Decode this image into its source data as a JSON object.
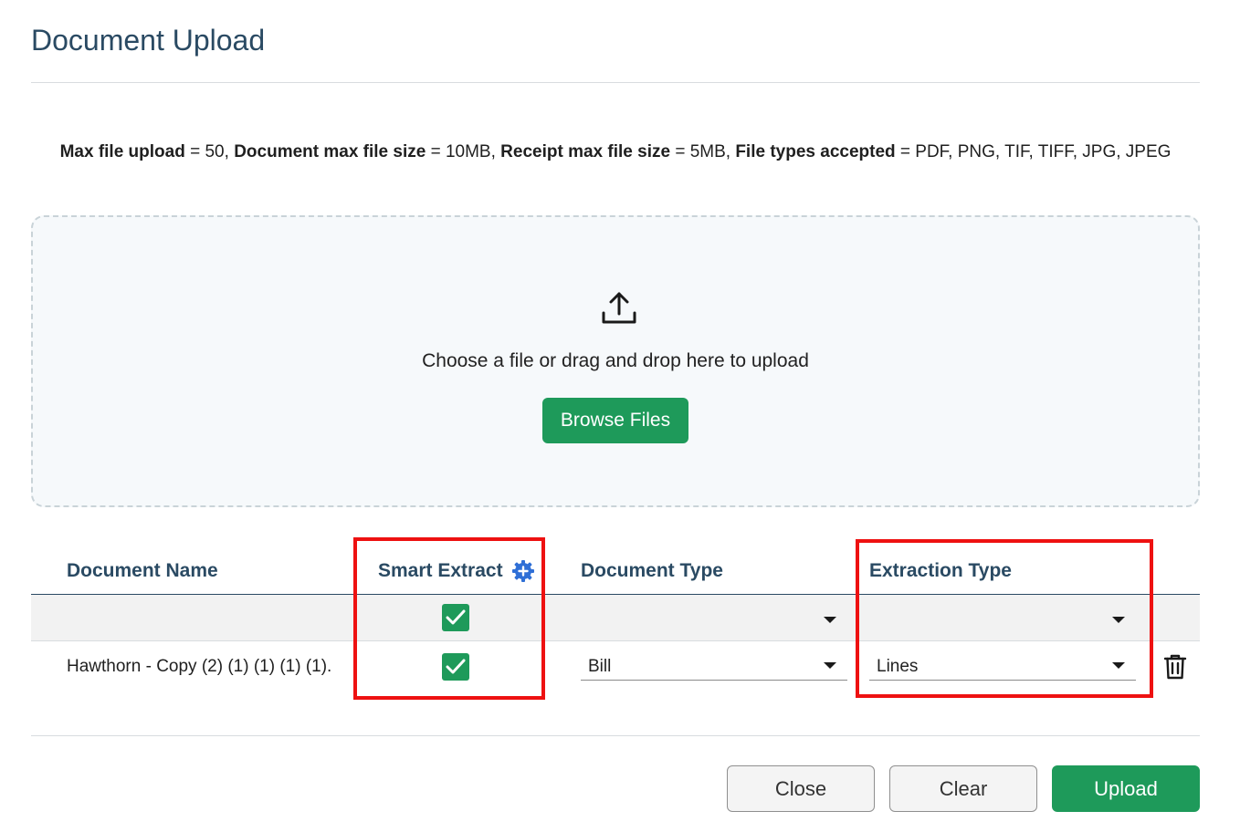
{
  "page": {
    "title": "Document Upload"
  },
  "limits": {
    "max_upload_label": "Max file upload",
    "max_upload_value": " = 50, ",
    "doc_size_label": "Document max file size",
    "doc_size_value": " = 10MB, ",
    "receipt_size_label": "Receipt max file size",
    "receipt_size_value": " = 5MB, ",
    "types_label": "File types accepted",
    "types_value": " = PDF, PNG, TIF, TIFF, JPG, JPEG"
  },
  "dropzone": {
    "icon": "upload-icon",
    "text": "Choose a file or drag and drop here to upload",
    "browse_label": "Browse Files"
  },
  "table": {
    "headers": {
      "name": "Document Name",
      "smart_extract": "Smart Extract",
      "document_type": "Document Type",
      "extraction_type": "Extraction Type"
    },
    "bulk_row": {
      "smart_extract_checked": true,
      "document_type": "",
      "extraction_type": ""
    },
    "rows": [
      {
        "name": "Hawthorn - Copy (2) (1) (1) (1) (1).",
        "smart_extract_checked": true,
        "document_type": "Bill",
        "extraction_type": "Lines"
      }
    ]
  },
  "footer": {
    "close_label": "Close",
    "clear_label": "Clear",
    "upload_label": "Upload"
  },
  "colors": {
    "primary": "#1e9a5a",
    "heading": "#2a4a63",
    "highlight": "#ee1111",
    "gear": "#2f6fd6"
  }
}
